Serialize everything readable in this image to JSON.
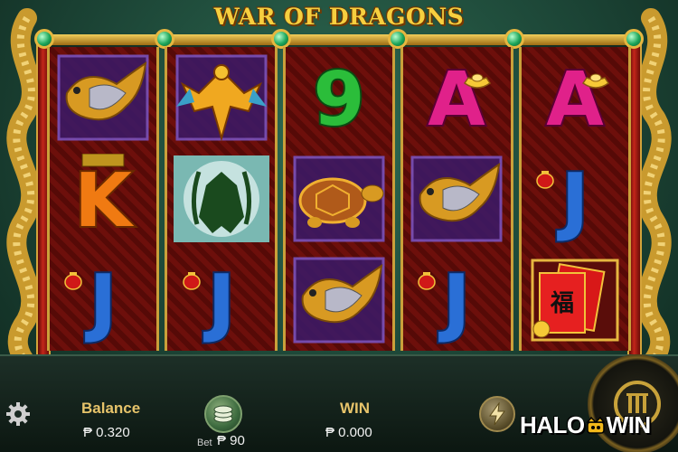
{
  "game": {
    "title": "WAR OF DRAGONS"
  },
  "reels": [
    {
      "symbols": [
        "golden-carp",
        "k",
        "j"
      ]
    },
    {
      "symbols": [
        "golden-phoenix",
        "dragon-wild",
        "j"
      ]
    },
    {
      "symbols": [
        "nine",
        "golden-turtle",
        "golden-carp"
      ]
    },
    {
      "symbols": [
        "a",
        "golden-carp",
        "j"
      ]
    },
    {
      "symbols": [
        "a",
        "j",
        "red-envelope"
      ]
    }
  ],
  "symbol_glyphs": {
    "k": "K",
    "j": "J",
    "a": "A",
    "nine": "9",
    "envelope_char": "福"
  },
  "hud": {
    "balance_label": "Balance",
    "balance_value": "₱ 0.320",
    "bet_prefix": "Bet",
    "bet_value": "₱ 90",
    "win_label": "WIN",
    "win_value": "₱ 0.000"
  },
  "watermark": {
    "left": "HALO",
    "right": "WIN"
  },
  "icons": {
    "settings": "gear-icon",
    "bet": "coin-stack-icon",
    "turbo": "lightning-icon",
    "spin": "spin-icon"
  },
  "colors": {
    "gold": "#f6cf3f",
    "reel_red": "#6d0f0b",
    "letter_blue": "#2a6fd6",
    "letter_magenta": "#e0218a",
    "nine_green": "#2bbd3a",
    "k_orange": "#f07a12"
  }
}
